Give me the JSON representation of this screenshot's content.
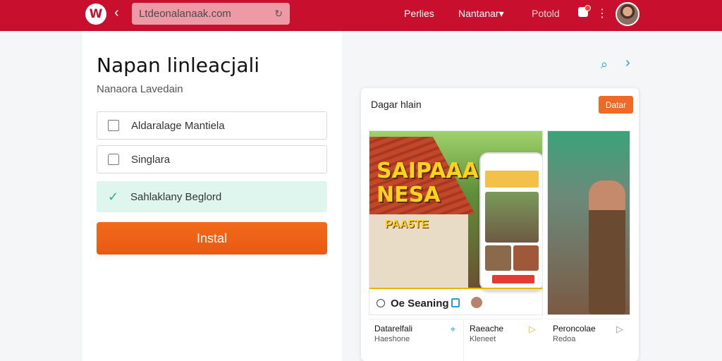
{
  "header": {
    "logo_text": "W",
    "back_glyph": "‹",
    "url": "Ltdeonalanaak.com",
    "nav": [
      "Perlies",
      "Nantanar▾",
      "Potold"
    ],
    "accent": "#c8102e",
    "icons": [
      "back-chevron-icon",
      "reload-icon",
      "bell-icon",
      "more-vertical-icon",
      "avatar"
    ]
  },
  "form": {
    "title": "Napan linleacjali",
    "subtitle": "Nanaora Lavedain",
    "fields": [
      {
        "label": "Aldaralage Mantiela",
        "icon": "folder-icon"
      },
      {
        "label": "Singlara",
        "icon": "home-icon"
      },
      {
        "label": "Sahlaklany Beglord",
        "icon": "check-icon",
        "state": "success"
      }
    ],
    "install_label": "Instal",
    "install_color": "#e85a12"
  },
  "preview": {
    "header": "Dagar hlain",
    "header_button": "Datar",
    "shot_headline": "SAIPAAA NESA",
    "shot_subheadline": "PAA5TE",
    "shot_caption": "Oe Seaning",
    "cards": [
      {
        "title": "Datarelfali",
        "sub": "Haeshone"
      },
      {
        "title": "Raeache",
        "sub": "Kleneet"
      },
      {
        "title": "Peroncolae",
        "sub": "Redoa"
      }
    ]
  }
}
